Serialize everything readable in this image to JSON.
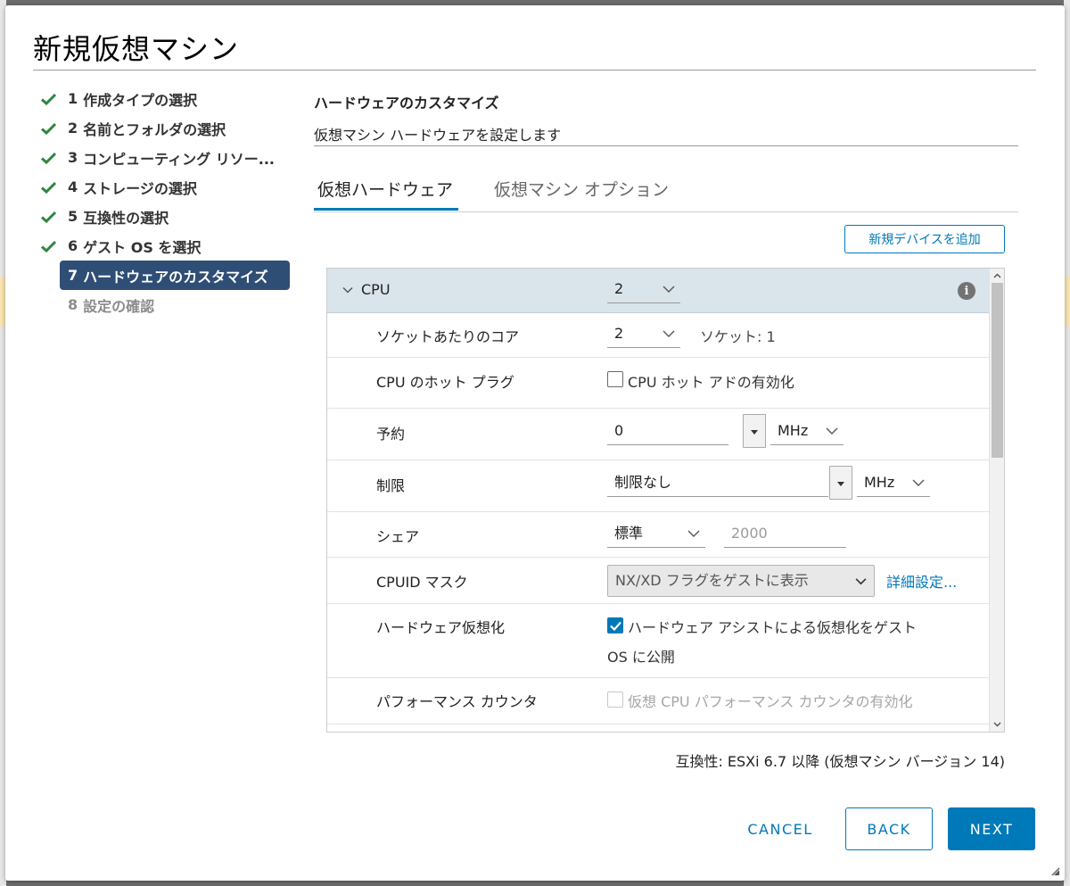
{
  "dialog": {
    "title": "新規仮想マシン"
  },
  "steps": [
    {
      "num": "1",
      "label": "作成タイプの選択",
      "state": "done"
    },
    {
      "num": "2",
      "label": "名前とフォルダの選択",
      "state": "done"
    },
    {
      "num": "3",
      "label": "コンピューティング リソー...",
      "state": "done"
    },
    {
      "num": "4",
      "label": "ストレージの選択",
      "state": "done"
    },
    {
      "num": "5",
      "label": "互換性の選択",
      "state": "done"
    },
    {
      "num": "6",
      "label": "ゲスト OS を選択",
      "state": "done"
    },
    {
      "num": "7",
      "label": "ハードウェアのカスタマイズ",
      "state": "active"
    },
    {
      "num": "8",
      "label": "設定の確認",
      "state": "disabled"
    }
  ],
  "pane": {
    "heading": "ハードウェアのカスタマイズ",
    "subheading": "仮想マシン ハードウェアを設定します"
  },
  "tabs": [
    {
      "label": "仮想ハードウェア",
      "active": true
    },
    {
      "label": "仮想マシン オプション",
      "active": false
    }
  ],
  "add_device_label": "新規デバイスを追加",
  "cpu": {
    "label": "CPU",
    "value": "2",
    "rows": {
      "cores_per_socket": {
        "label": "ソケットあたりのコア",
        "value": "2",
        "sockets_text": "ソケット: 1"
      },
      "hot_plug": {
        "label": "CPU のホット プラグ",
        "checkbox_label": "CPU ホット アドの有効化",
        "checked": false
      },
      "reservation": {
        "label": "予約",
        "value": "0",
        "unit": "MHz"
      },
      "limit": {
        "label": "制限",
        "value": "制限なし",
        "unit": "MHz"
      },
      "shares": {
        "label": "シェア",
        "value": "標準",
        "number": "2000"
      },
      "cpuid_mask": {
        "label": "CPUID マスク",
        "value": "NX/XD フラグをゲストに表示",
        "link": "詳細設定..."
      },
      "hw_virt": {
        "label": "ハードウェア仮想化",
        "checkbox_label_1": "ハードウェア アシストによる仮想化をゲスト",
        "checkbox_label_2": "OS に公開",
        "checked": true
      },
      "perf_counters": {
        "label": "パフォーマンス カウンタ",
        "checkbox_label": "仮想 CPU パフォーマンス カウンタの有効化",
        "checked": false,
        "disabled": true
      }
    }
  },
  "compatibility_text": "互換性: ESXi 6.7 以降 (仮想マシン バージョン 14)",
  "buttons": {
    "cancel": "CANCEL",
    "back": "BACK",
    "next": "NEXT"
  },
  "colors": {
    "accent": "#0079b8",
    "active_step_bg": "#2f4e76",
    "check_green": "#2e8540",
    "cpu_header_bg": "#dae4eb"
  }
}
